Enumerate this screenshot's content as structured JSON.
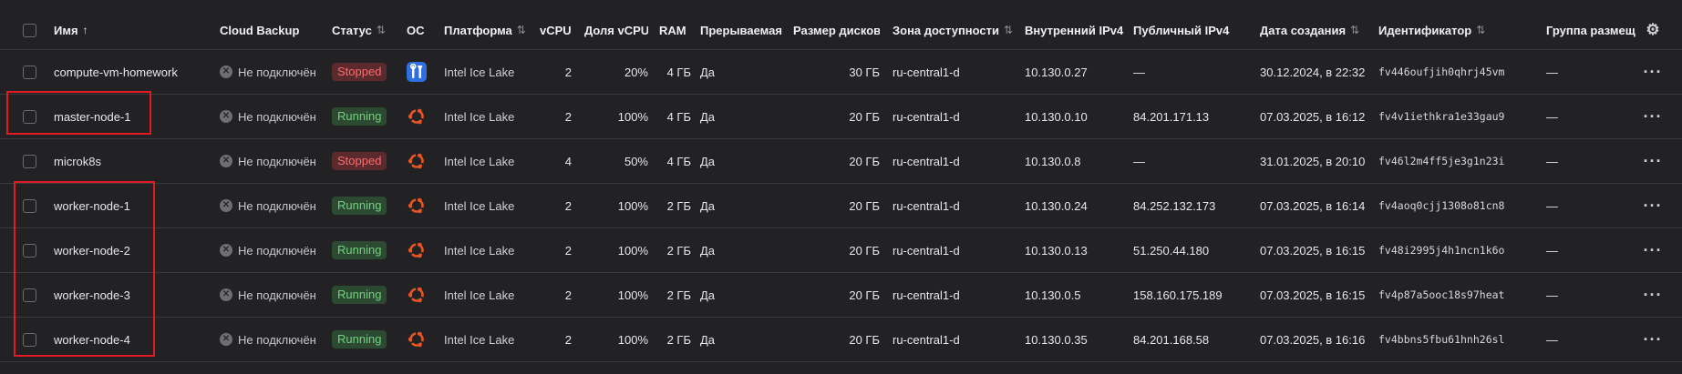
{
  "header": {
    "name": "Имя",
    "name_sort": "↑",
    "backup": "Cloud Backup",
    "status": "Статус",
    "os": "ОС",
    "platform": "Платформа",
    "vcpu": "vCPU",
    "vcpu_share": "Доля vCPU",
    "ram": "RAM",
    "preemptible": "Прерываемая",
    "disk_size": "Размер дисков",
    "zone": "Зона доступности",
    "internal_ip": "Внутренний IPv4",
    "public_ip": "Публичный IPv4",
    "created": "Дата создания",
    "id": "Идентификатор",
    "placement": "Группа размещ",
    "sort_icon": "⇅",
    "settings_icon": "gear-icon"
  },
  "rows": [
    {
      "name": "compute-vm-homework",
      "backup": "Не подключён",
      "status": "Stopped",
      "os": "tools",
      "platform": "Intel Ice Lake",
      "vcpu": "2",
      "vcpu_share": "20%",
      "ram": "4 ГБ",
      "preemptible": "Да",
      "disk": "30 ГБ",
      "zone": "ru-central1-d",
      "internal_ip": "10.130.0.27",
      "public_ip": "—",
      "created": "30.12.2024, в 22:32",
      "id": "fv446oufjih0qhrj45vm",
      "placement": "—"
    },
    {
      "name": "master-node-1",
      "backup": "Не подключён",
      "status": "Running",
      "os": "ubuntu",
      "platform": "Intel Ice Lake",
      "vcpu": "2",
      "vcpu_share": "100%",
      "ram": "4 ГБ",
      "preemptible": "Да",
      "disk": "20 ГБ",
      "zone": "ru-central1-d",
      "internal_ip": "10.130.0.10",
      "public_ip": "84.201.171.13",
      "created": "07.03.2025, в 16:12",
      "id": "fv4v1iethkra1e33gau9",
      "placement": "—"
    },
    {
      "name": "microk8s",
      "backup": "Не подключён",
      "status": "Stopped",
      "os": "ubuntu",
      "platform": "Intel Ice Lake",
      "vcpu": "4",
      "vcpu_share": "50%",
      "ram": "4 ГБ",
      "preemptible": "Да",
      "disk": "20 ГБ",
      "zone": "ru-central1-d",
      "internal_ip": "10.130.0.8",
      "public_ip": "—",
      "created": "31.01.2025, в 20:10",
      "id": "fv46l2m4ff5je3g1n23i",
      "placement": "—"
    },
    {
      "name": "worker-node-1",
      "backup": "Не подключён",
      "status": "Running",
      "os": "ubuntu",
      "platform": "Intel Ice Lake",
      "vcpu": "2",
      "vcpu_share": "100%",
      "ram": "2 ГБ",
      "preemptible": "Да",
      "disk": "20 ГБ",
      "zone": "ru-central1-d",
      "internal_ip": "10.130.0.24",
      "public_ip": "84.252.132.173",
      "created": "07.03.2025, в 16:14",
      "id": "fv4aoq0cjj1308o81cn8",
      "placement": "—"
    },
    {
      "name": "worker-node-2",
      "backup": "Не подключён",
      "status": "Running",
      "os": "ubuntu",
      "platform": "Intel Ice Lake",
      "vcpu": "2",
      "vcpu_share": "100%",
      "ram": "2 ГБ",
      "preemptible": "Да",
      "disk": "20 ГБ",
      "zone": "ru-central1-d",
      "internal_ip": "10.130.0.13",
      "public_ip": "51.250.44.180",
      "created": "07.03.2025, в 16:15",
      "id": "fv48i2995j4h1ncn1k6o",
      "placement": "—"
    },
    {
      "name": "worker-node-3",
      "backup": "Не подключён",
      "status": "Running",
      "os": "ubuntu",
      "platform": "Intel Ice Lake",
      "vcpu": "2",
      "vcpu_share": "100%",
      "ram": "2 ГБ",
      "preemptible": "Да",
      "disk": "20 ГБ",
      "zone": "ru-central1-d",
      "internal_ip": "10.130.0.5",
      "public_ip": "158.160.175.189",
      "created": "07.03.2025, в 16:15",
      "id": "fv4p87a5ooc18s97heat",
      "placement": "—"
    },
    {
      "name": "worker-node-4",
      "backup": "Не подключён",
      "status": "Running",
      "os": "ubuntu",
      "platform": "Intel Ice Lake",
      "vcpu": "2",
      "vcpu_share": "100%",
      "ram": "2 ГБ",
      "preemptible": "Да",
      "disk": "20 ГБ",
      "zone": "ru-central1-d",
      "internal_ip": "10.130.0.35",
      "public_ip": "84.201.168.58",
      "created": "07.03.2025, в 16:16",
      "id": "fv4bbns5fbu61hnh26sl",
      "placement": "—"
    }
  ],
  "colors": {
    "stopped": "#ff6b70",
    "running": "#74d07f",
    "highlight": "#e21b23",
    "ubuntu": "#e95420",
    "tools": "#2f6fe0"
  }
}
